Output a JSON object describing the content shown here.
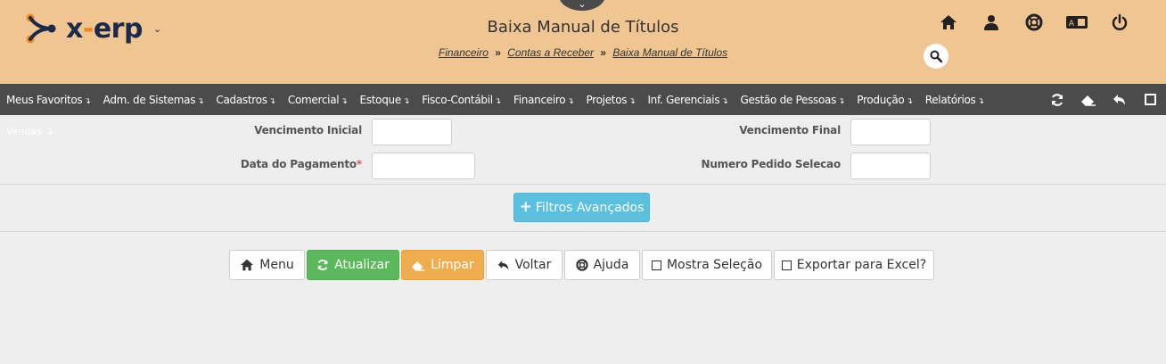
{
  "app": {
    "logo_text_pre": "x",
    "logo_text_dash": "-",
    "logo_text_post": "erp",
    "logo_caret": "⌄"
  },
  "header": {
    "title": "Baixa Manual de Títulos",
    "breadcrumb": [
      "Financeiro",
      "Contas a Receber",
      "Baixa Manual de Títulos"
    ],
    "breadcrumb_sep": "»",
    "notch_icon": "chevron-down-icon"
  },
  "top_icons": [
    "home-icon",
    "user-icon",
    "lifebuoy-icon",
    "translate-icon",
    "power-icon"
  ],
  "nav": {
    "items": [
      "Meus Favoritos",
      "Adm. de Sistemas",
      "Cadastros",
      "Comercial",
      "Estoque",
      "Fisco-Contábil",
      "Financeiro",
      "Projetos",
      "Inf. Gerenciais",
      "Gestão de Pessoas",
      "Produção",
      "Relatórios"
    ],
    "caret": "↴",
    "sub_item": "Vendas ↴",
    "actions": [
      "refresh-icon",
      "eraser-icon",
      "undo-icon",
      "square-icon"
    ]
  },
  "form": {
    "vencimento_inicial": {
      "label": "Vencimento Inicial",
      "value": ""
    },
    "vencimento_final": {
      "label": "Vencimento Final",
      "value": ""
    },
    "data_pagamento": {
      "label": "Data do Pagamento",
      "required_mark": "*",
      "value": ""
    },
    "numero_pedido": {
      "label": "Numero Pedido Selecao",
      "value": ""
    }
  },
  "filtros_button": {
    "icon": "+",
    "label": "Filtros Avançados"
  },
  "buttons": {
    "menu": "Menu",
    "atualizar": "Atualizar",
    "limpar": "Limpar",
    "voltar": "Voltar",
    "ajuda": "Ajuda",
    "mostra_selecao": "Mostra Seleção",
    "exportar_excel": "Exportar para Excel?"
  },
  "colors": {
    "header_bg": "#efc592",
    "navbar_bg": "#4b4b4b",
    "accent_orange": "#f18a1c",
    "logo_navy": "#1b2a4a",
    "info": "#5bc0de",
    "success": "#5cb85c",
    "warning": "#f0ad4e"
  }
}
